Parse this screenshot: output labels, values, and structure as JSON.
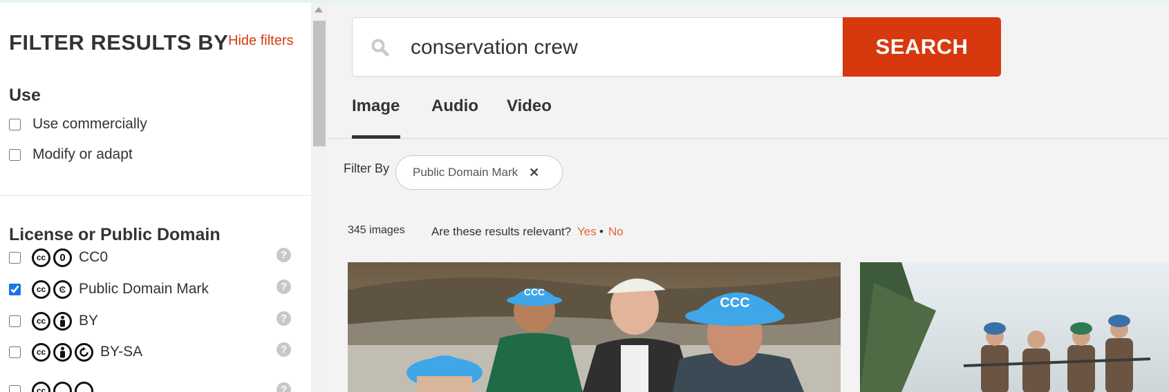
{
  "sidebar": {
    "heading": "FILTER RESULTS BY",
    "hide_filters": "Hide filters",
    "use": {
      "title": "Use",
      "options": [
        {
          "label": "Use commercially",
          "checked": false
        },
        {
          "label": "Modify or adapt",
          "checked": false
        }
      ]
    },
    "license": {
      "title": "License or Public Domain",
      "options": [
        {
          "label": "CC0",
          "checked": false,
          "icons": [
            "cc-icon",
            "zero-icon"
          ]
        },
        {
          "label": "Public Domain Mark",
          "checked": true,
          "icons": [
            "cc-icon",
            "pd-icon"
          ]
        },
        {
          "label": "BY",
          "checked": false,
          "icons": [
            "cc-icon",
            "by-icon"
          ]
        },
        {
          "label": "BY-SA",
          "checked": false,
          "icons": [
            "cc-icon",
            "by-icon",
            "sa-icon"
          ]
        }
      ],
      "help_glyph": "?"
    }
  },
  "search": {
    "query": "conservation crew",
    "button_label": "SEARCH"
  },
  "tabs": [
    {
      "label": "Image",
      "active": true
    },
    {
      "label": "Audio",
      "active": false
    },
    {
      "label": "Video",
      "active": false
    }
  ],
  "filter_by": {
    "label": "Filter By",
    "chip": "Public Domain Mark",
    "chip_close": "✕"
  },
  "results": {
    "count": "345 images",
    "relevance_question": "Are these results relevant?",
    "yes": "Yes",
    "separator": "•",
    "no": "No"
  },
  "hardhat_text": "CCC",
  "colors": {
    "accent": "#d7380e",
    "link": "#e8613a",
    "checkbox": "#1a73e8",
    "hardhat": "#3fa6e8"
  }
}
